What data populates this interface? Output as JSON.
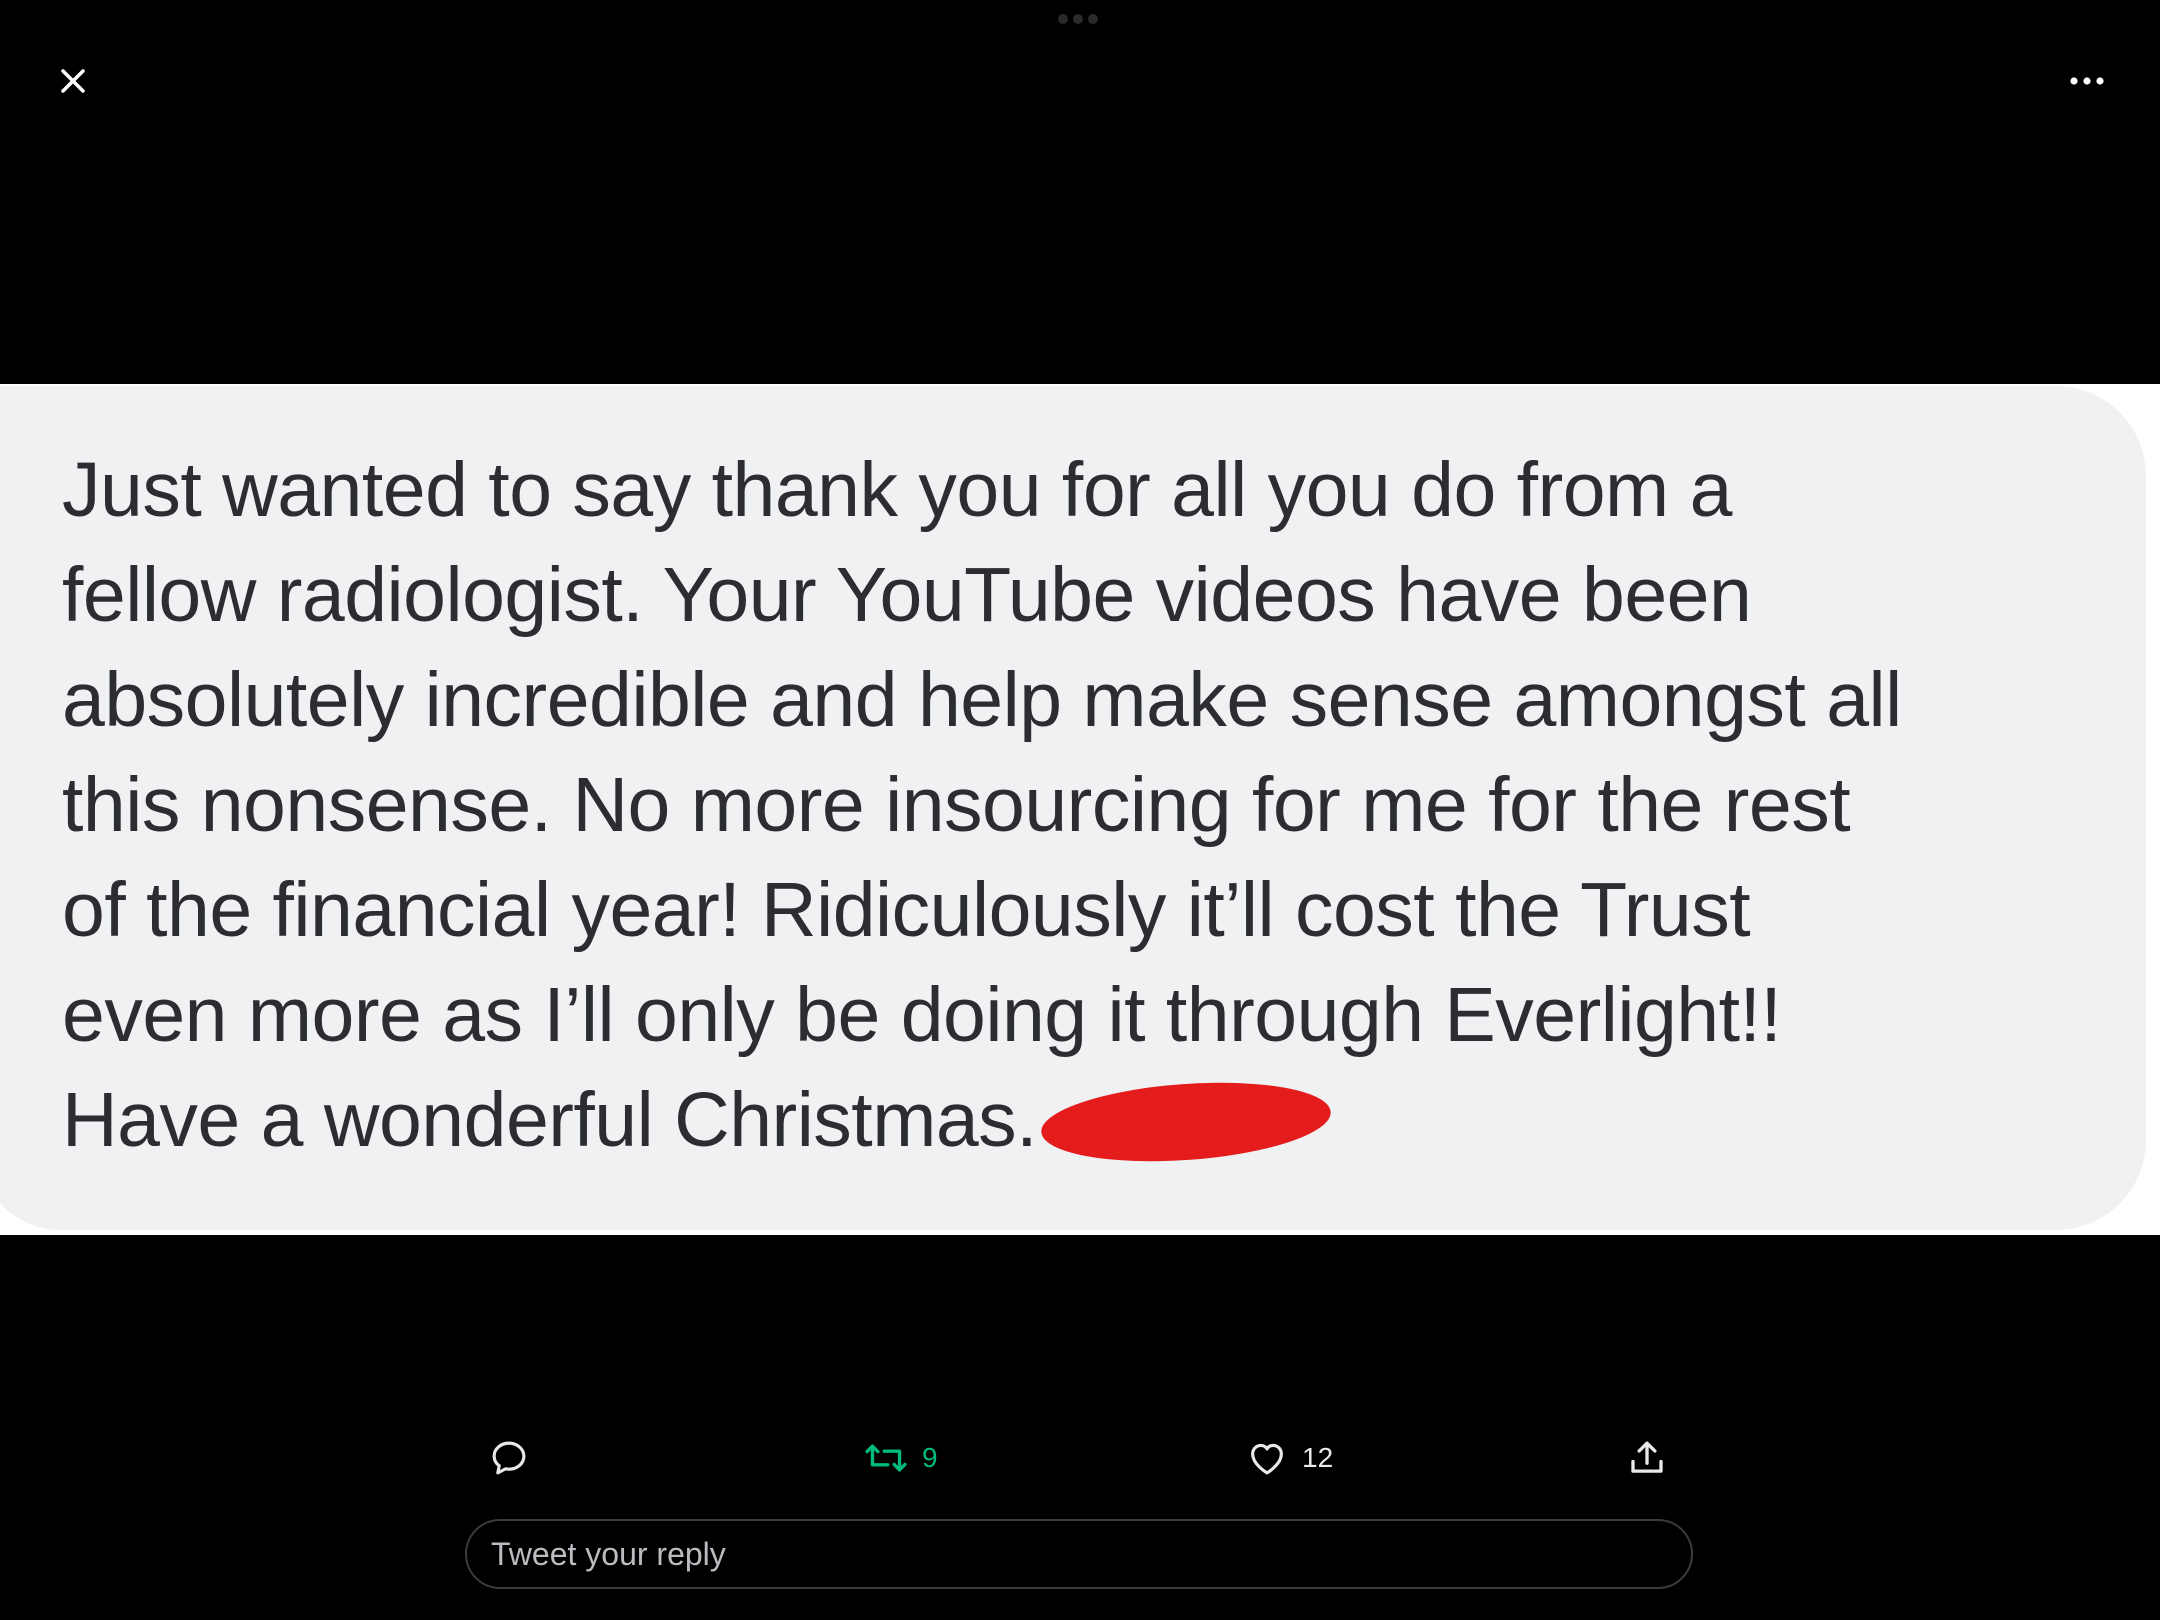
{
  "header": {
    "close_icon": "close-icon",
    "more_icon": "more-horizontal-icon"
  },
  "media": {
    "message_lines": [
      "Just wanted to say thank you for all you do from a",
      "fellow radiologist. Your YouTube videos have been",
      "absolutely incredible and help make sense amongst all",
      "this nonsense. No more insourcing for me for the rest",
      "of the financial year! Ridiculously it’ll cost the Trust",
      "even more as I’ll only be doing it through Everlight!!",
      "Have a wonderful Christmas."
    ],
    "redaction_color": "#e41c1c"
  },
  "actions": {
    "reply": {
      "icon": "reply-icon"
    },
    "retweet": {
      "icon": "retweet-icon",
      "count": "9",
      "color": "#00ba7c"
    },
    "like": {
      "icon": "heart-icon",
      "count": "12",
      "color": "#e7e9ea"
    },
    "share": {
      "icon": "share-icon"
    }
  },
  "reply_input": {
    "placeholder": "Tweet your reply"
  }
}
